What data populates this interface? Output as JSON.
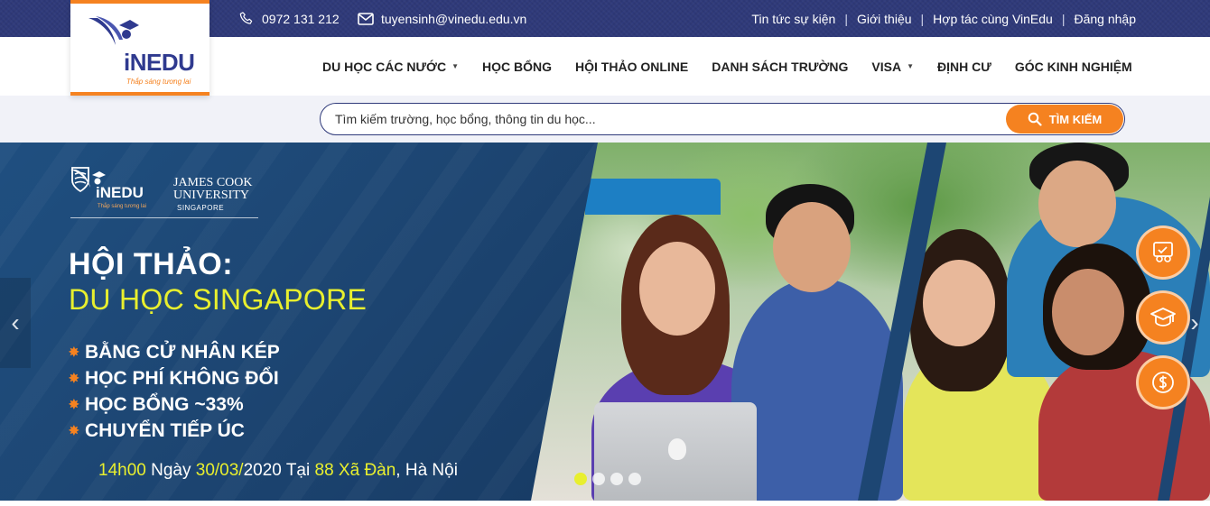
{
  "topbar": {
    "phone": "0972 131 212",
    "email": "tuyensinh@vinedu.edu.vn",
    "links": [
      "Tin tức sự kiện",
      "Giới thiệu",
      "Hợp tác cùng VinEdu",
      "Đăng nhập"
    ],
    "separator": "|"
  },
  "logo": {
    "in": "iN",
    "edu": "EDU",
    "tagline": "Thắp sáng tương lai"
  },
  "nav": {
    "items": [
      {
        "label": "DU HỌC CÁC NƯỚC",
        "caret": "▼"
      },
      {
        "label": "HỌC BỔNG"
      },
      {
        "label": "HỘI THẢO ONLINE"
      },
      {
        "label": "DANH SÁCH TRƯỜNG"
      },
      {
        "label": "VISA",
        "caret": "▼"
      },
      {
        "label": "ĐỊNH CƯ"
      },
      {
        "label": "GÓC KINH NGHIỆM"
      }
    ]
  },
  "search": {
    "placeholder": "Tìm kiếm trường, học bổng, thông tin du học...",
    "button_label": "TÌM KIẾM"
  },
  "hero": {
    "brand": {
      "inedu": "iNEDU",
      "tagline": "Thắp sáng tương lai",
      "jcu_line1": "JAMES COOK",
      "jcu_line2": "UNIVERSITY",
      "jcu_sub": "SINGAPORE"
    },
    "title": "HỘI THẢO:",
    "subtitle": "DU HỌC SINGAPORE",
    "bullets": [
      "BẰNG CỬ NHÂN KÉP",
      "HỌC PHÍ KHÔNG ĐỔI",
      "HỌC BỔNG ~33%",
      "CHUYỂN TIẾP ÚC"
    ],
    "bullet_glyph": "✸",
    "event": {
      "time": "14h00",
      "day_word": "Ngày",
      "date": "30/03/",
      "year": "2020",
      "at": "Tại",
      "number": "88",
      "street": "Xã Đàn",
      "city": ", Hà Nội"
    },
    "arrows": {
      "left": "‹",
      "right": "›"
    },
    "slide_count": 4,
    "active_slide": 1
  },
  "colors": {
    "navy": "#2f3a7a",
    "orange": "#f58220",
    "yellow": "#e8ef2e",
    "hero_blue": "#1d4673"
  },
  "float_buttons": [
    "consult-icon",
    "graduation-cap-icon",
    "dollar-icon"
  ]
}
